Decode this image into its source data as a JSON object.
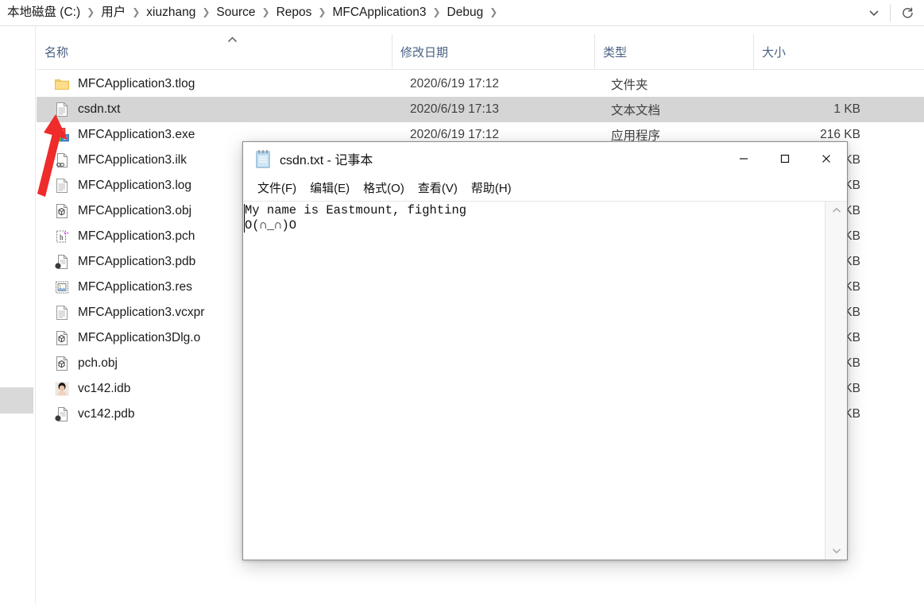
{
  "window_title": "csdn.txt - 记事本",
  "explorer": {
    "breadcrumb": {
      "items": [
        {
          "label": "本地磁盘 (C:)"
        },
        {
          "label": "用户"
        },
        {
          "label": "xiuzhang"
        },
        {
          "label": "Source"
        },
        {
          "label": "Repos"
        },
        {
          "label": "MFCApplication3"
        },
        {
          "label": "Debug"
        }
      ],
      "separator": "❯",
      "dropdown_icon": "chevron-down-icon",
      "refresh_icon": "refresh-icon"
    },
    "columns": [
      {
        "key": "name",
        "label": "名称",
        "sorted": "asc",
        "sort_indicator": "^"
      },
      {
        "key": "date",
        "label": "修改日期"
      },
      {
        "key": "type",
        "label": "类型"
      },
      {
        "key": "size",
        "label": "大小"
      }
    ],
    "rows": [
      {
        "name": "MFCApplication3.tlog",
        "date": "2020/6/19 17:12",
        "type": "文件夹",
        "size": "",
        "icon": "folder-icon",
        "selected": false
      },
      {
        "name": "csdn.txt",
        "date": "2020/6/19 17:13",
        "type": "文本文档",
        "size": "1 KB",
        "icon": "text-file-icon",
        "selected": true
      },
      {
        "name": "MFCApplication3.exe",
        "date": "2020/6/19 17:12",
        "type": "应用程序",
        "size": "216 KB",
        "icon": "mfc-exe-icon",
        "selected": false
      },
      {
        "name": "MFCApplication3.ilk",
        "date": "",
        "type": "",
        "size": "KB",
        "icon": "ilk-file-icon",
        "selected": false
      },
      {
        "name": "MFCApplication3.log",
        "date": "",
        "type": "",
        "size": "KB",
        "icon": "text-file-icon",
        "selected": false
      },
      {
        "name": "MFCApplication3.obj",
        "date": "",
        "type": "",
        "size": "KB",
        "icon": "obj-file-icon",
        "selected": false
      },
      {
        "name": "MFCApplication3.pch",
        "date": "",
        "type": "",
        "size": "KB",
        "icon": "pch-file-icon",
        "selected": false
      },
      {
        "name": "MFCApplication3.pdb",
        "date": "",
        "type": "",
        "size": "KB",
        "icon": "pdb-file-icon",
        "selected": false
      },
      {
        "name": "MFCApplication3.res",
        "date": "",
        "type": "",
        "size": "KB",
        "icon": "res-file-icon",
        "selected": false
      },
      {
        "name": "MFCApplication3.vcxpr",
        "date": "",
        "type": "",
        "size": "KB",
        "icon": "text-file-icon",
        "selected": false
      },
      {
        "name": "MFCApplication3Dlg.o",
        "date": "",
        "type": "",
        "size": "KB",
        "icon": "obj-file-icon",
        "selected": false
      },
      {
        "name": "pch.obj",
        "date": "",
        "type": "",
        "size": "KB",
        "icon": "obj-file-icon",
        "selected": false
      },
      {
        "name": "vc142.idb",
        "date": "",
        "type": "",
        "size": "KB",
        "icon": "photo-file-icon",
        "selected": false
      },
      {
        "name": "vc142.pdb",
        "date": "",
        "type": "",
        "size": "KB",
        "icon": "pdb-file-icon",
        "selected": false
      }
    ]
  },
  "notepad": {
    "title": "csdn.txt - 记事本",
    "app_icon": "notepad-icon",
    "menu": [
      {
        "label": "文件(F)"
      },
      {
        "label": "编辑(E)"
      },
      {
        "label": "格式(O)"
      },
      {
        "label": "查看(V)"
      },
      {
        "label": "帮助(H)"
      }
    ],
    "content": "My name is Eastmount, fighting\nO(∩_∩)O",
    "buttons": {
      "minimize": "minimize-icon",
      "maximize": "maximize-icon",
      "close": "close-icon"
    },
    "scrollbar": {
      "up": "▲",
      "down": "▼"
    }
  },
  "annotation": {
    "arrow_color": "#ef2b2b",
    "points_to": "csdn.txt"
  },
  "colors": {
    "selection": "#d5d5d5",
    "header_text": "#4a6184",
    "accent_red": "#ef2b2b"
  }
}
